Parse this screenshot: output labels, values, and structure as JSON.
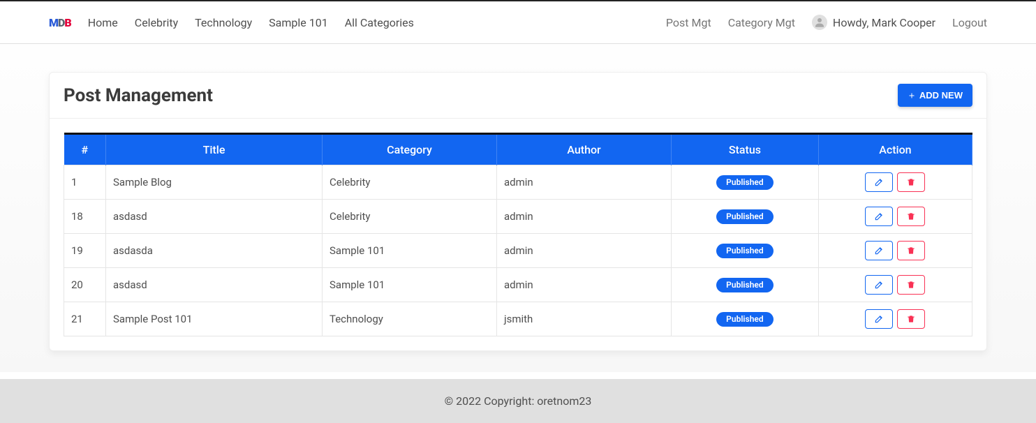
{
  "nav": {
    "logo": {
      "m": "M",
      "d": "D",
      "b": "B"
    },
    "left": [
      "Home",
      "Celebrity",
      "Technology",
      "Sample 101",
      "All Categories"
    ],
    "right": {
      "post_mgt": "Post Mgt",
      "cat_mgt": "Category Mgt",
      "howdy": "Howdy, Mark Cooper",
      "logout": "Logout"
    }
  },
  "page": {
    "title": "Post Management",
    "add_btn": "ADD NEW"
  },
  "table": {
    "headers": [
      "#",
      "Title",
      "Category",
      "Author",
      "Status",
      "Action"
    ],
    "rows": [
      {
        "id": "1",
        "title": "Sample Blog",
        "category": "Celebrity",
        "author": "admin",
        "status": "Published"
      },
      {
        "id": "18",
        "title": "asdasd",
        "category": "Celebrity",
        "author": "admin",
        "status": "Published"
      },
      {
        "id": "19",
        "title": "asdasda",
        "category": "Sample 101",
        "author": "admin",
        "status": "Published"
      },
      {
        "id": "20",
        "title": "asdasd",
        "category": "Sample 101",
        "author": "admin",
        "status": "Published"
      },
      {
        "id": "21",
        "title": "Sample Post 101",
        "category": "Technology",
        "author": "jsmith",
        "status": "Published"
      }
    ]
  },
  "footer": {
    "copyright": "© 2022 Copyright: ",
    "link": "oretnom23"
  }
}
